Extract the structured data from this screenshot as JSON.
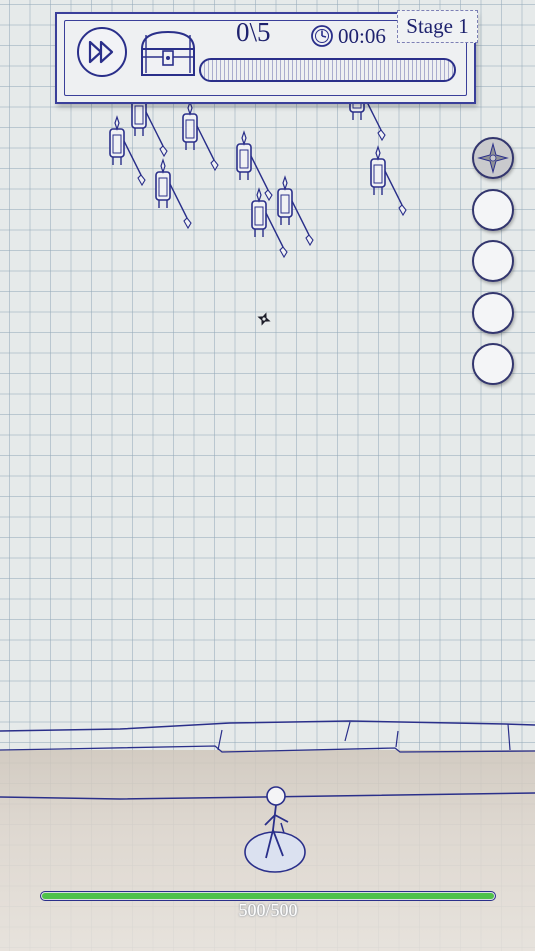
{
  "hud": {
    "kills": "0\\5",
    "timer": "00:06",
    "stage": "Stage 1",
    "progress_fraction": 0.0
  },
  "skill_slots": [
    {
      "name": "skill-slot-1",
      "filled": true
    },
    {
      "name": "skill-slot-2",
      "filled": false
    },
    {
      "name": "skill-slot-3",
      "filled": false
    },
    {
      "name": "skill-slot-4",
      "filled": false
    },
    {
      "name": "skill-slot-5",
      "filled": false
    }
  ],
  "player": {
    "health_text": "500/500",
    "health_fraction": 1.0
  },
  "colors": {
    "ink": "#2a2f8a",
    "health": "#4fc24a",
    "paper": "#e6eaea"
  },
  "icons": {
    "fast_forward": "fast-forward-icon",
    "chest": "treasure-chest-icon",
    "timer": "clock-icon"
  }
}
